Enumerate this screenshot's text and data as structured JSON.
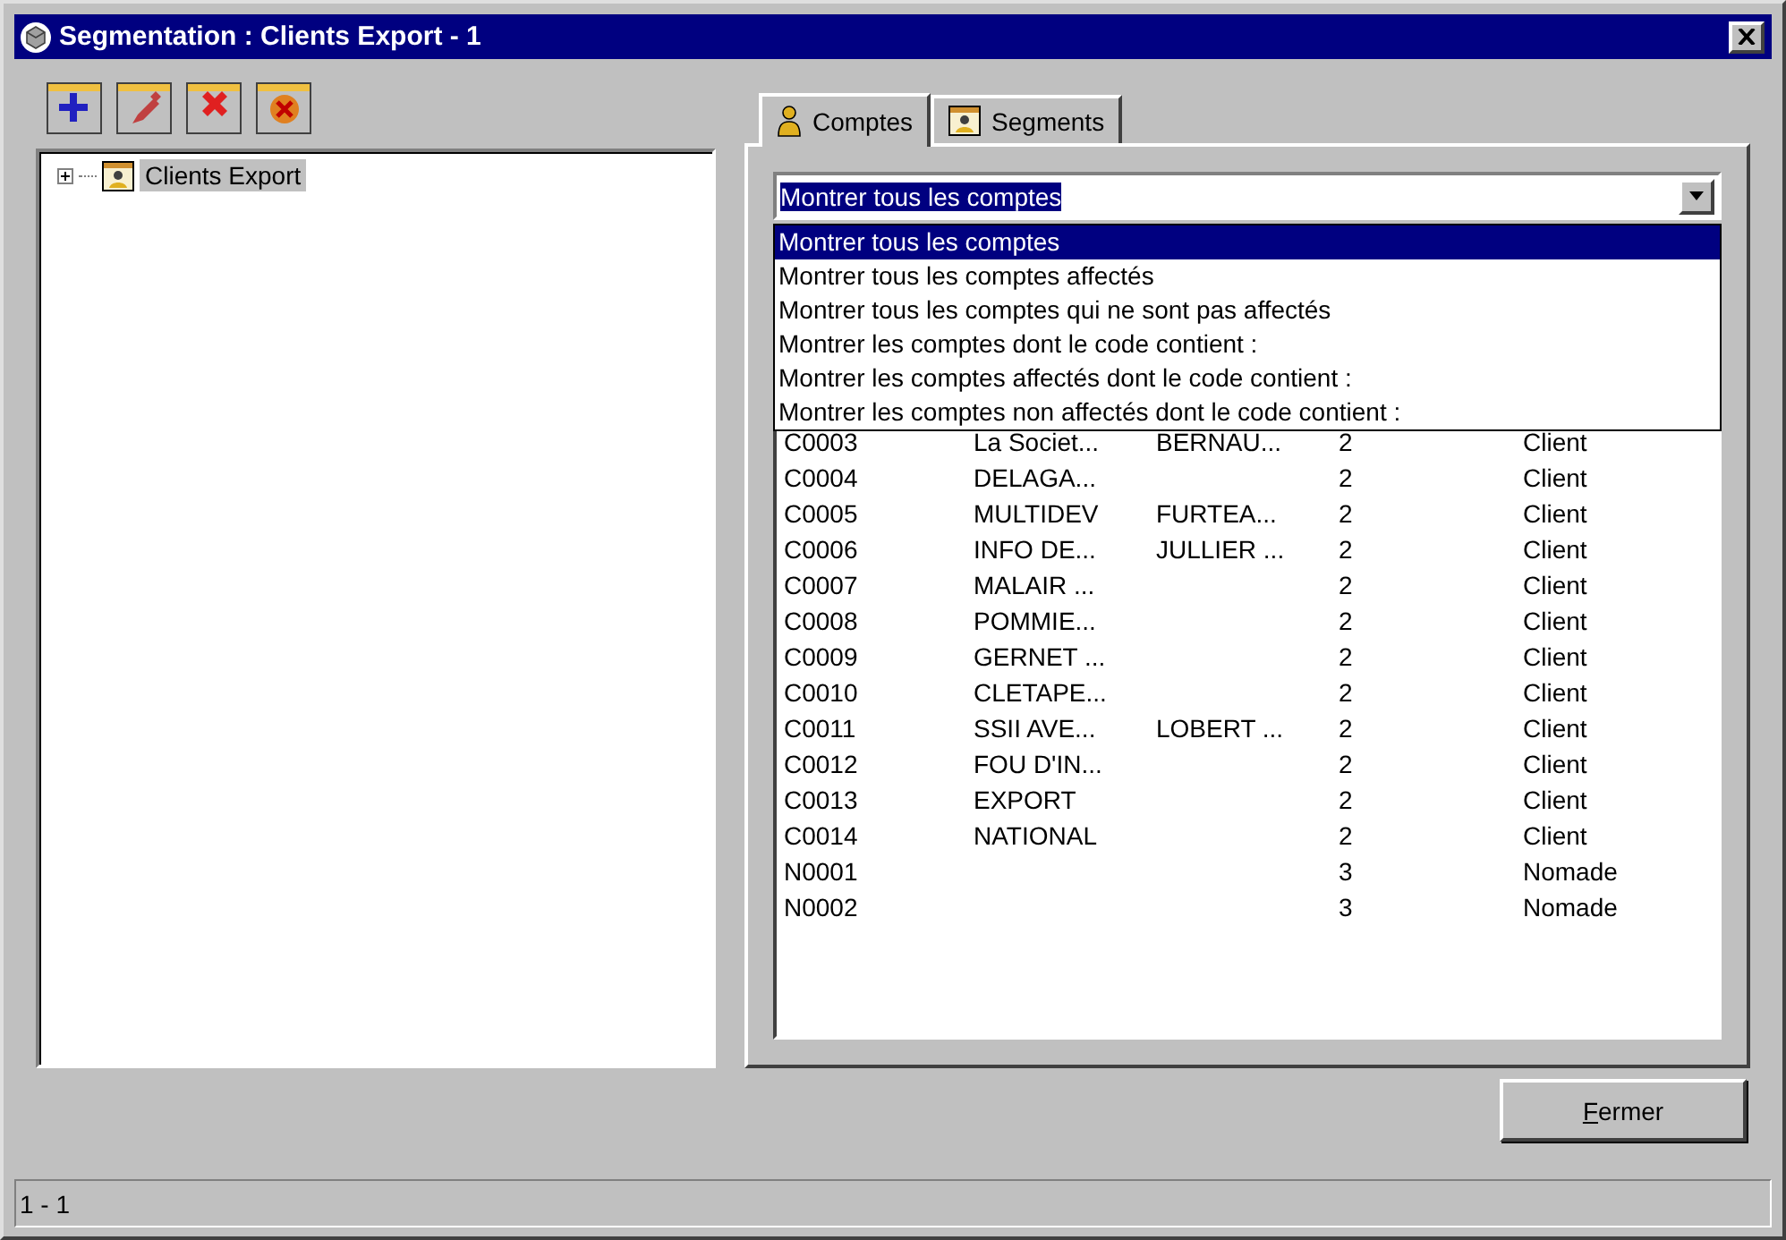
{
  "window": {
    "title": "Segmentation : Clients Export - 1"
  },
  "toolbar": [
    {
      "kind": "add"
    },
    {
      "kind": "edit"
    },
    {
      "kind": "delete"
    },
    {
      "kind": "cancel"
    }
  ],
  "tree": [
    {
      "label": "Clients Export",
      "expanded": false,
      "selected": true
    }
  ],
  "tabs": [
    {
      "label": "Comptes",
      "kind": "person",
      "selected": true
    },
    {
      "label": "Segments",
      "kind": "segment",
      "selected": false
    }
  ],
  "filter": {
    "value": "Montrer tous les comptes",
    "options": [
      {
        "label": "Montrer tous les comptes",
        "selected": true
      },
      {
        "label": "Montrer tous les comptes affectés",
        "selected": false
      },
      {
        "label": "Montrer tous les comptes qui ne sont pas affectés",
        "selected": false
      },
      {
        "label": "Montrer les comptes dont le code contient :",
        "selected": false
      },
      {
        "label": "Montrer les comptes affectés dont le code contient :",
        "selected": false
      },
      {
        "label": "Montrer les comptes non affectés dont le code contient :",
        "selected": false
      }
    ]
  },
  "table": {
    "rows": [
      [
        "C0003",
        "La Societ...",
        "BERNAU...",
        "2",
        "Client"
      ],
      [
        "C0004",
        "DELAGA...",
        "",
        "2",
        "Client"
      ],
      [
        "C0005",
        "MULTIDEV",
        "FURTEA...",
        "2",
        "Client"
      ],
      [
        "C0006",
        "INFO DE...",
        "JULLIER ...",
        "2",
        "Client"
      ],
      [
        "C0007",
        "MALAIR ...",
        "",
        "2",
        "Client"
      ],
      [
        "C0008",
        "POMMIE...",
        "",
        "2",
        "Client"
      ],
      [
        "C0009",
        "GERNET ...",
        "",
        "2",
        "Client"
      ],
      [
        "C0010",
        "CLETAPE...",
        "",
        "2",
        "Client"
      ],
      [
        "C0011",
        "SSII AVE...",
        "LOBERT ...",
        "2",
        "Client"
      ],
      [
        "C0012",
        "FOU D'IN...",
        "",
        "2",
        "Client"
      ],
      [
        "C0013",
        "EXPORT",
        "",
        "2",
        "Client"
      ],
      [
        "C0014",
        "NATIONAL",
        "",
        "2",
        "Client"
      ],
      [
        "N0001",
        "",
        "",
        "3",
        "Nomade"
      ],
      [
        "N0002",
        "",
        "",
        "3",
        "Nomade"
      ]
    ]
  },
  "buttons": [
    {
      "label": "Fermer"
    }
  ],
  "status_bar": "1 - 1"
}
